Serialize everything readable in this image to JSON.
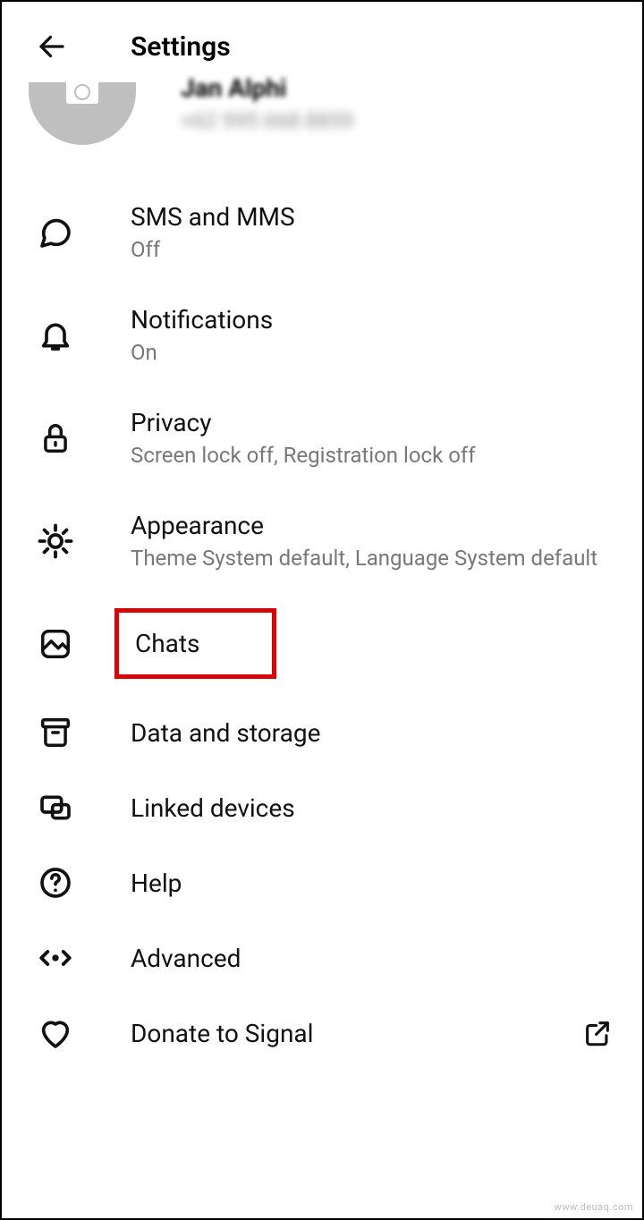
{
  "header": {
    "title": "Settings"
  },
  "profile": {
    "name": "Jan Alphi",
    "phone": "+62 995 668 8859"
  },
  "items": {
    "sms": {
      "title": "SMS and MMS",
      "sub": "Off"
    },
    "notifications": {
      "title": "Notifications",
      "sub": "On"
    },
    "privacy": {
      "title": "Privacy",
      "sub": "Screen lock off, Registration lock off"
    },
    "appearance": {
      "title": "Appearance",
      "sub": "Theme System default, Language System default"
    },
    "chats": {
      "title": "Chats"
    },
    "data": {
      "title": "Data and storage"
    },
    "linked": {
      "title": "Linked devices"
    },
    "help": {
      "title": "Help"
    },
    "advanced": {
      "title": "Advanced"
    },
    "donate": {
      "title": "Donate to Signal"
    }
  },
  "watermark": "www.deuaq.com"
}
